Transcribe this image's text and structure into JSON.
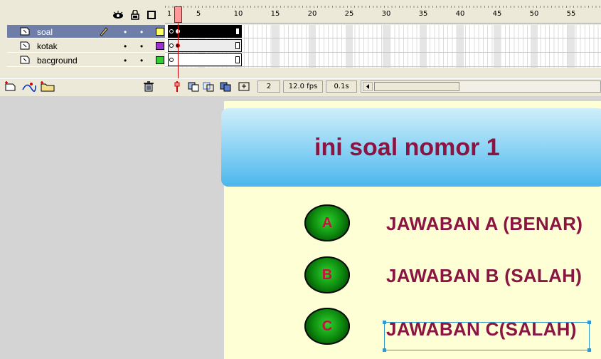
{
  "timeline": {
    "header_icons": [
      "eye-icon",
      "lock-icon",
      "outline-icon"
    ],
    "ruler_numbers": [
      "1",
      "5",
      "10",
      "15",
      "20",
      "25",
      "30",
      "35",
      "40",
      "45",
      "50",
      "55"
    ],
    "layers": [
      {
        "name": "soal",
        "active": true,
        "color": "#ffff66",
        "icon": "layer-icon",
        "editing": true
      },
      {
        "name": "kotak",
        "active": false,
        "color": "#9933cc",
        "icon": "layer-icon",
        "editing": false
      },
      {
        "name": "bacground",
        "active": false,
        "color": "#33cc33",
        "icon": "layer-icon",
        "editing": false
      }
    ],
    "toolbar": {
      "insert_layer_icons": [
        "insert-layer-icon",
        "motion-guide-icon",
        "insert-folder-icon"
      ],
      "delete_icon": "trash-icon",
      "current_frame": "2",
      "frame_rate": "12.0 fps",
      "elapsed_time": "0.1s"
    }
  },
  "stage": {
    "title": "ini soal nomor 1",
    "options": [
      {
        "letter": "A",
        "label": "JAWABAN A (BENAR)"
      },
      {
        "letter": "B",
        "label": "JAWABAN B (SALAH)"
      },
      {
        "letter": "C",
        "label": "JAWABAN C(SALAH)"
      }
    ],
    "colors": {
      "title_text": "#8a1442",
      "option_text": "#8a1442",
      "button_letter": "#c8103c",
      "stage_background": "#ffffd6",
      "banner": "#8ed4f5"
    }
  }
}
